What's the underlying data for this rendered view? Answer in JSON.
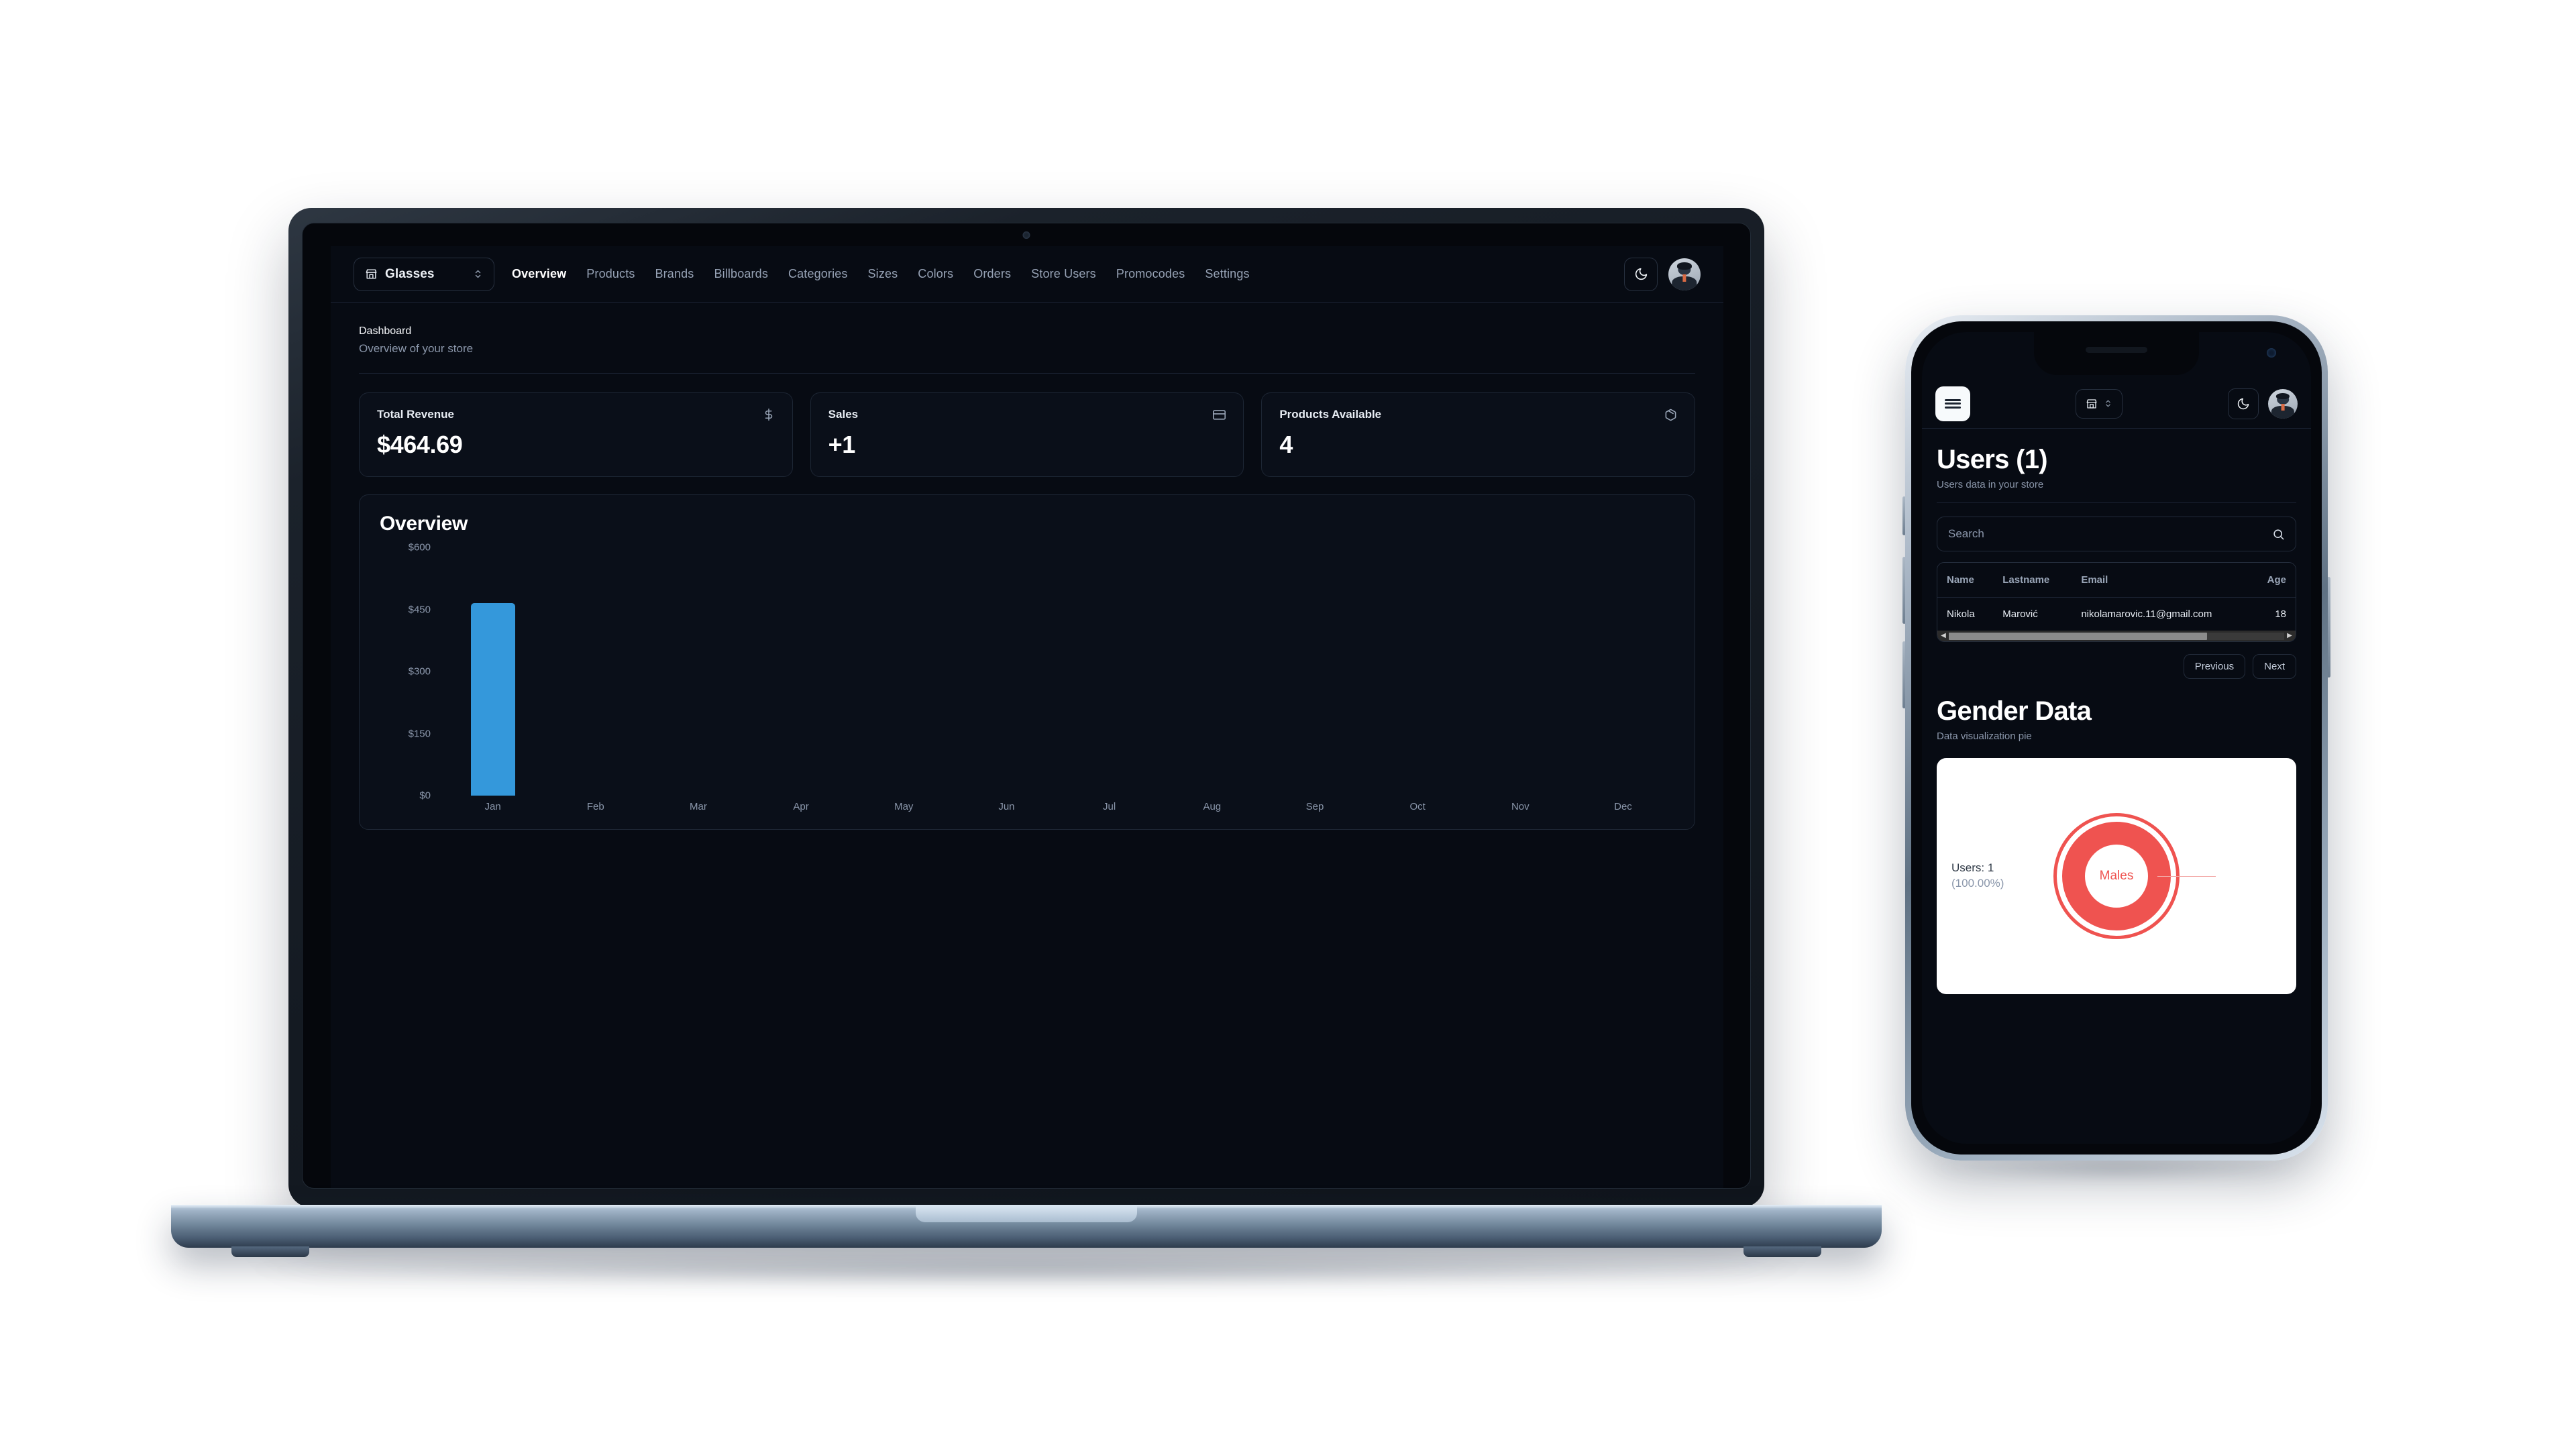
{
  "desktop": {
    "topbar": {
      "store_selector": {
        "label": "Glasses",
        "icon": "store-icon",
        "chevron_icon": "chevron-updown-icon"
      },
      "nav": [
        {
          "label": "Overview",
          "active": true
        },
        {
          "label": "Products",
          "active": false
        },
        {
          "label": "Brands",
          "active": false
        },
        {
          "label": "Billboards",
          "active": false
        },
        {
          "label": "Categories",
          "active": false
        },
        {
          "label": "Sizes",
          "active": false
        },
        {
          "label": "Colors",
          "active": false
        },
        {
          "label": "Orders",
          "active": false
        },
        {
          "label": "Store Users",
          "active": false
        },
        {
          "label": "Promocodes",
          "active": false
        },
        {
          "label": "Settings",
          "active": false
        }
      ],
      "theme_toggle_icon": "moon-icon",
      "avatar": "user-avatar"
    },
    "header": {
      "title": "Dashboard",
      "subtitle": "Overview of your store"
    },
    "stats": [
      {
        "label": "Total Revenue",
        "value": "$464.69",
        "icon": "dollar-icon"
      },
      {
        "label": "Sales",
        "value": "+1",
        "icon": "credit-card-icon"
      },
      {
        "label": "Products Available",
        "value": "4",
        "icon": "package-icon"
      }
    ],
    "chart_title": "Overview"
  },
  "chart_data": {
    "type": "bar",
    "title": "Overview",
    "categories": [
      "Jan",
      "Feb",
      "Mar",
      "Apr",
      "May",
      "Jun",
      "Jul",
      "Aug",
      "Sep",
      "Oct",
      "Nov",
      "Dec"
    ],
    "values": [
      464.69,
      0,
      0,
      0,
      0,
      0,
      0,
      0,
      0,
      0,
      0,
      0
    ],
    "ytick_labels": [
      "$600",
      "$450",
      "$300",
      "$150",
      "$0"
    ],
    "ytick_values": [
      600,
      450,
      300,
      150,
      0
    ],
    "ylim": [
      0,
      600
    ],
    "xlabel": "",
    "ylabel": "",
    "grid": false,
    "legend": false,
    "bar_color": "#3498db"
  },
  "mobile": {
    "topbar": {
      "menu_icon": "hamburger-menu-icon",
      "store_selector": {
        "icon": "store-icon",
        "chevron_icon": "chevron-updown-icon"
      },
      "theme_toggle_icon": "moon-icon",
      "avatar": "user-avatar"
    },
    "header": {
      "title": "Users (1)",
      "subtitle": "Users data in your store"
    },
    "search": {
      "placeholder": "Search",
      "value": "",
      "icon": "search-icon"
    },
    "table": {
      "columns": [
        "Name",
        "Lastname",
        "Email",
        "Age"
      ],
      "rows": [
        {
          "name": "Nikola",
          "lastname": "Marović",
          "email": "nikolamarovic.11@gmail.com",
          "age": "18"
        }
      ],
      "scrollbar": {
        "left_arrow": "◀",
        "right_arrow": "▶"
      }
    },
    "pagination": {
      "previous": "Previous",
      "next": "Next"
    },
    "pie_section": {
      "title": "Gender Data",
      "subtitle": "Data visualization pie"
    },
    "pie_chart_data": {
      "type": "pie",
      "title": "Gender Data",
      "labels": [
        "Males"
      ],
      "values": [
        1
      ],
      "percentages": [
        "100.00%"
      ],
      "annotation_line1": "Users: 1",
      "annotation_line2": "(100.00%)",
      "center_label": "Males",
      "color": "#ef5350"
    }
  }
}
